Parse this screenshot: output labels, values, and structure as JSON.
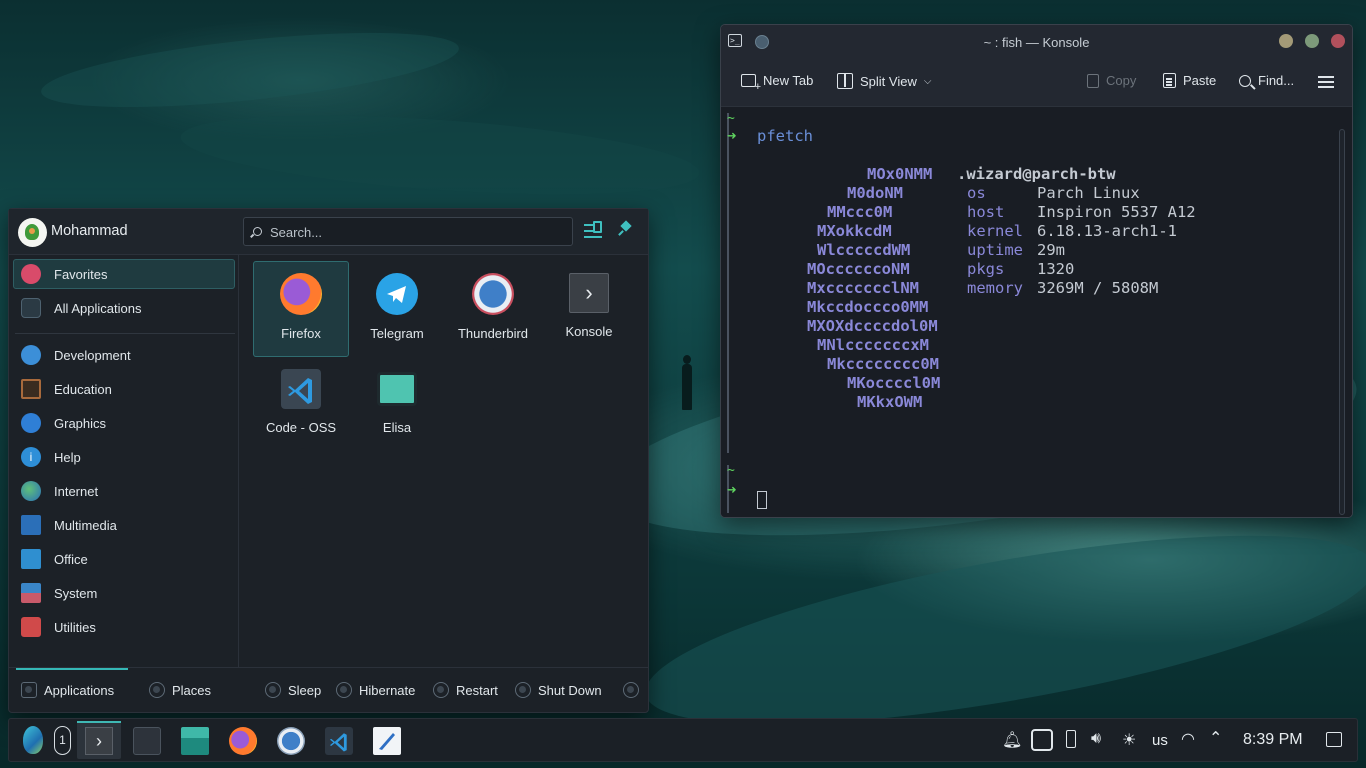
{
  "konsole": {
    "title": "~ : fish — Konsole",
    "toolbar": {
      "new_tab": "New Tab",
      "split_view": "Split View",
      "copy": "Copy",
      "paste": "Paste",
      "find": "Find..."
    },
    "terminal": {
      "prompt_dir": "~",
      "prompt_arrow": "➜",
      "command": "pfetch",
      "user_host": ".wizard@parch-btw",
      "logo_lines": [
        "MOx0NMM",
        "M0doNM",
        "MMccc0M",
        "MXokkcdM",
        "WlcccccdWM",
        "MOccccccoNM",
        "MxccccccclNM",
        "Mkccdoccco0MM",
        "MXOXdccccdol0M",
        "MNlcccccccxM",
        "Mkcccccccc0M",
        "MKoccccl0M",
        "MKkxOWM"
      ],
      "info": [
        {
          "label": "os",
          "value": "Parch Linux"
        },
        {
          "label": "host",
          "value": "Inspiron 5537 A12"
        },
        {
          "label": "kernel",
          "value": "6.18.13-arch1-1"
        },
        {
          "label": "uptime",
          "value": "29m"
        },
        {
          "label": "pkgs",
          "value": "1320"
        },
        {
          "label": "memory",
          "value": "3269M / 5808M"
        }
      ]
    }
  },
  "launcher": {
    "username": "Mohammad",
    "search_placeholder": "Search...",
    "categories": [
      {
        "label": "Favorites",
        "icon": "heart-icon",
        "color": "#d94b6a"
      },
      {
        "label": "All Applications",
        "icon": "grid-icon",
        "color": "#2b3a44"
      },
      {
        "label": "Development",
        "icon": "hammer-icon",
        "color": "#3c8fd8"
      },
      {
        "label": "Education",
        "icon": "chalkboard-icon",
        "color": "#a86a3c"
      },
      {
        "label": "Graphics",
        "icon": "palette-icon",
        "color": "#2f7fd6"
      },
      {
        "label": "Help",
        "icon": "info-icon",
        "color": "#2e8fd8"
      },
      {
        "label": "Internet",
        "icon": "globe-icon",
        "color": "#3aa06a"
      },
      {
        "label": "Multimedia",
        "icon": "media-icon",
        "color": "#2b6fb8"
      },
      {
        "label": "Office",
        "icon": "document-icon",
        "color": "#2f8fd0"
      },
      {
        "label": "System",
        "icon": "system-icon",
        "color": "#3a86c8"
      },
      {
        "label": "Utilities",
        "icon": "toolbox-icon",
        "color": "#d04a4a"
      }
    ],
    "apps": [
      {
        "label": "Firefox",
        "icon": "firefox-icon"
      },
      {
        "label": "Telegram",
        "icon": "telegram-icon"
      },
      {
        "label": "Thunderbird",
        "icon": "thunderbird-icon"
      },
      {
        "label": "Konsole",
        "icon": "konsole-icon"
      },
      {
        "label": "Code - OSS",
        "icon": "vscode-icon"
      },
      {
        "label": "Elisa",
        "icon": "elisa-icon"
      }
    ],
    "footer": {
      "applications": "Applications",
      "places": "Places",
      "sleep": "Sleep",
      "hibernate": "Hibernate",
      "restart": "Restart",
      "shutdown": "Shut Down"
    }
  },
  "taskbar": {
    "workspace": "1",
    "keyboard_layout": "us",
    "clock": "8:39 PM",
    "tasks": [
      "launcher-icon",
      "konsole-icon",
      "settings-icon",
      "files-icon",
      "firefox-icon",
      "thunderbird-icon",
      "vscode-icon",
      "writer-icon"
    ]
  }
}
